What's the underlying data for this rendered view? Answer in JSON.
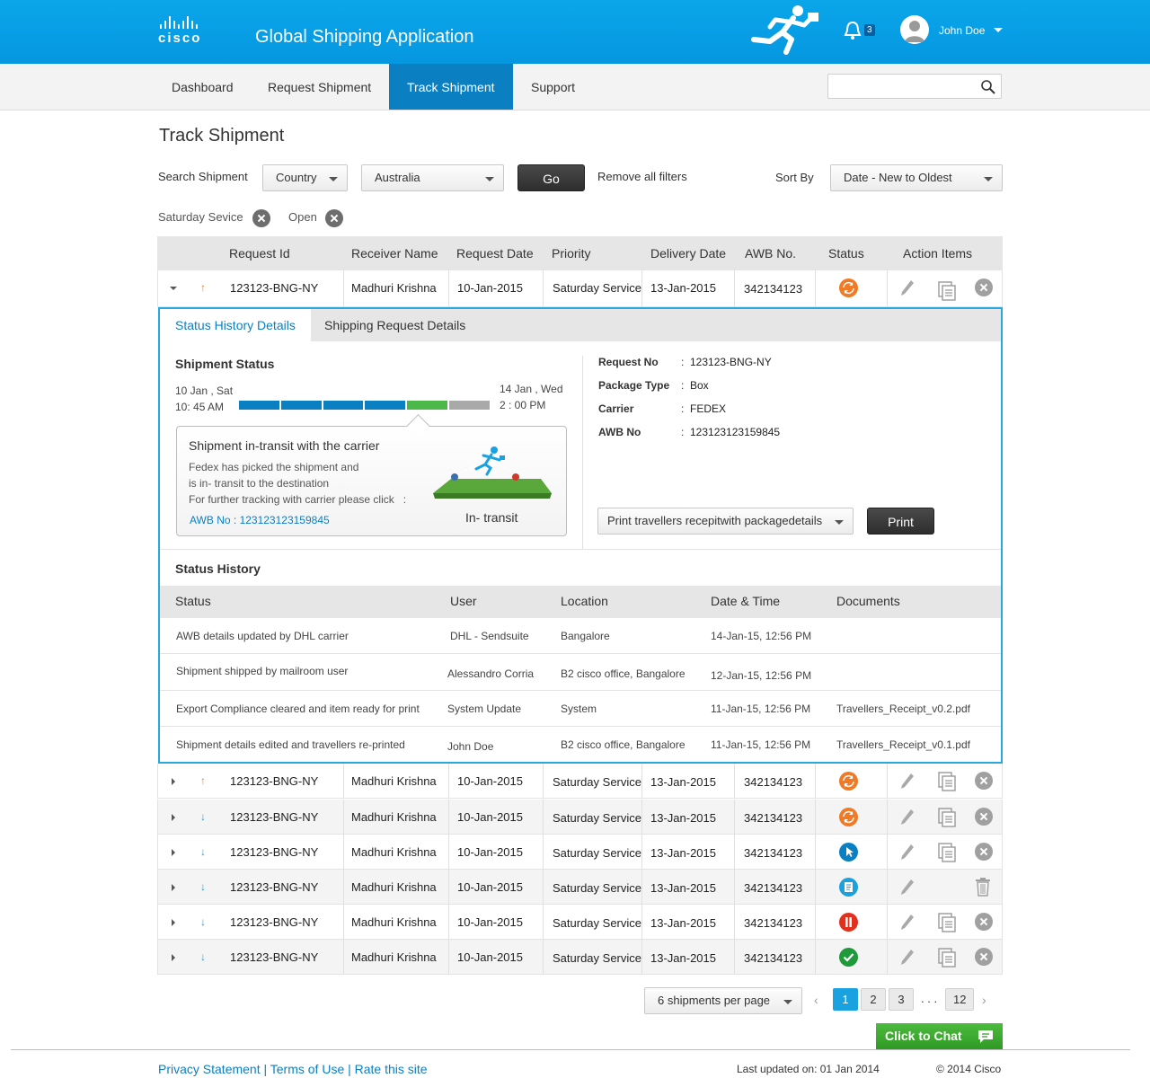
{
  "header": {
    "brand": "cisco",
    "app_title": "Global Shipping Application",
    "notification_count": "3",
    "user_name": "John Doe"
  },
  "nav": {
    "items": [
      "Dashboard",
      "Request Shipment",
      "Track Shipment",
      "Support"
    ],
    "active": "Track Shipment",
    "search_placeholder": ""
  },
  "page": {
    "title": "Track Shipment"
  },
  "filters": {
    "search_label": "Search Shipment",
    "field_select": "Country",
    "value_select": "Australia",
    "go_label": "Go",
    "remove_all": "Remove all filters",
    "sort_label": "Sort By",
    "sort_value": "Date - New to Oldest",
    "chips": [
      "Saturday Sevice",
      "Open"
    ]
  },
  "table": {
    "headers": [
      "Request Id",
      "Receiver Name",
      "Request Date",
      "Priority",
      "Delivery Date",
      "AWB No.",
      "Status",
      "Action Items"
    ],
    "rows": [
      {
        "id": "123123-BNG-NY",
        "receiver": "Madhuri Krishna",
        "req_date": "10-Jan-2015",
        "priority": "Saturday Service",
        "del_date": "13-Jan-2015",
        "awb": "342134123",
        "direction": "up",
        "status": "in-transit"
      },
      {
        "id": "123123-BNG-NY",
        "receiver": "Madhuri Krishna",
        "req_date": "10-Jan-2015",
        "priority": "Saturday Service",
        "del_date": "13-Jan-2015",
        "awb": "342134123",
        "direction": "up",
        "status": "in-transit"
      },
      {
        "id": "123123-BNG-NY",
        "receiver": "Madhuri Krishna",
        "req_date": "10-Jan-2015",
        "priority": "Saturday Service",
        "del_date": "13-Jan-2015",
        "awb": "342134123",
        "direction": "down",
        "status": "in-transit"
      },
      {
        "id": "123123-BNG-NY",
        "receiver": "Madhuri Krishna",
        "req_date": "10-Jan-2015",
        "priority": "Saturday Service",
        "del_date": "13-Jan-2015",
        "awb": "342134123",
        "direction": "down",
        "status": "clicked"
      },
      {
        "id": "123123-BNG-NY",
        "receiver": "Madhuri Krishna",
        "req_date": "10-Jan-2015",
        "priority": "Saturday Service",
        "del_date": "13-Jan-2015",
        "awb": "342134123",
        "direction": "down",
        "status": "document"
      },
      {
        "id": "123123-BNG-NY",
        "receiver": "Madhuri Krishna",
        "req_date": "10-Jan-2015",
        "priority": "Saturday Service",
        "del_date": "13-Jan-2015",
        "awb": "342134123",
        "direction": "down",
        "status": "paused"
      },
      {
        "id": "123123-BNG-NY",
        "receiver": "Madhuri Krishna",
        "req_date": "10-Jan-2015",
        "priority": "Saturday Service",
        "del_date": "13-Jan-2015",
        "awb": "342134123",
        "direction": "down",
        "status": "delivered"
      }
    ]
  },
  "details": {
    "tabs": [
      "Status History Details",
      "Shipping Request Details"
    ],
    "shipment_status_title": "Shipment Status",
    "start_date": "10 Jan , Sat",
    "start_time": "10: 45 AM",
    "end_date": "14  Jan , Wed",
    "end_time": "2 : 00 PM",
    "progress_completed_segments": 4,
    "progress_current_segment": 5,
    "progress_total_segments": 6,
    "callout_title": "Shipment in-transit with the carrier",
    "callout_line1": "Fedex has picked the shipment and",
    "callout_line2": "is in- transit to the destination",
    "callout_line3": "For further tracking with carrier please click   :",
    "callout_link": "AWB No : 123123123159845",
    "callout_state": "In- transit",
    "info": [
      {
        "key": "Request No",
        "value": "123123-BNG-NY"
      },
      {
        "key": "Package Type",
        "value": "Box"
      },
      {
        "key": "Carrier",
        "value": "FEDEX"
      },
      {
        "key": "AWB No",
        "value": "123123123159845"
      }
    ],
    "print_select": "Print travellers recepitwith packagedetails",
    "print_label": "Print",
    "history_title": "Status History",
    "history_headers": [
      "Status",
      "User",
      "Location",
      "Date & Time",
      "Documents"
    ],
    "history": [
      {
        "status": "AWB details updated by DHL carrier",
        "user": "DHL - Sendsuite",
        "location": "Bangalore",
        "datetime": "14-Jan-15, 12:56 PM",
        "doc": ""
      },
      {
        "status": "Shipment shipped by mailroom user",
        "user": "Alessandro Corria",
        "location": "B2 cisco office, Bangalore",
        "datetime": "12-Jan-15, 12:56 PM",
        "doc": ""
      },
      {
        "status": "Export Compliance cleared and item ready for print",
        "user": "System Update",
        "location": "System",
        "datetime": "11-Jan-15, 12:56 PM",
        "doc": "Travellers_Receipt_v0.2.pdf"
      },
      {
        "status": "Shipment details edited and travellers re-printed",
        "user": "John Doe",
        "location": "B2 cisco office, Bangalore",
        "datetime": "11-Jan-15, 12:56 PM",
        "doc": "Travellers_Receipt_v0.1.pdf"
      }
    ]
  },
  "pagination": {
    "per_page": "6 shipments per page",
    "pages": [
      "1",
      "2",
      "3"
    ],
    "ellipsis": ". . .",
    "last": "12",
    "active": "1"
  },
  "chat_label": "Click to Chat",
  "footer": {
    "links": "Privacy Statement | Terms of Use | Rate this site",
    "updated": "Last updated on: 01 Jan 2014",
    "copyright": "© 2014 Cisco"
  },
  "colors": {
    "header_blue": "#0aa6ea",
    "nav_active": "#0a7fc2",
    "panel_border": "#29a8db",
    "progress_done": "#0a7fc2",
    "progress_current": "#4db84a",
    "progress_pending": "#a9a9a9",
    "status_orange": "#f07a25",
    "status_blue": "#0a7fc2",
    "status_cyan": "#1aa2e0",
    "status_red": "#e0311f",
    "status_green": "#1f9a3a"
  }
}
